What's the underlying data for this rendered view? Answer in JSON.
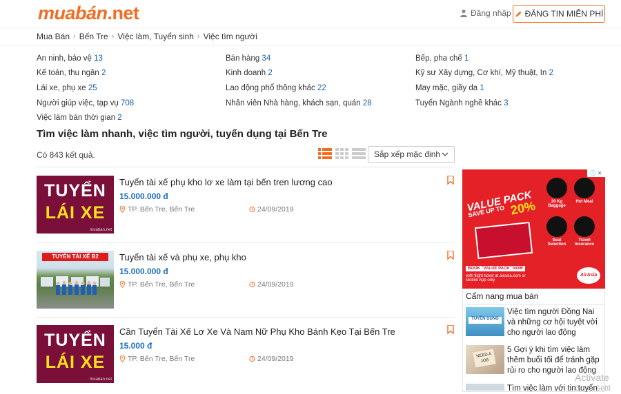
{
  "header": {
    "logo_main": "muabán",
    "logo_suffix": ".net",
    "login_label": "Đăng nhập",
    "post_button_label": "ĐĂNG TIN MIỄN PHÍ"
  },
  "breadcrumb": [
    "Mua Bán",
    "Bến Tre",
    "Việc làm, Tuyển sinh",
    "Việc tìm người"
  ],
  "categories": [
    {
      "label": "An ninh, bảo vệ",
      "count": "13"
    },
    {
      "label": "Bán hàng",
      "count": "34"
    },
    {
      "label": "Bếp, pha chế",
      "count": "1"
    },
    {
      "label": "Kế toán, thu ngân",
      "count": "2"
    },
    {
      "label": "Kinh doanh",
      "count": "2"
    },
    {
      "label": "Kỹ sư Xây dựng, Cơ khí, Mỹ thuật, In",
      "count": "2"
    },
    {
      "label": "Lái xe, phụ xe",
      "count": "25"
    },
    {
      "label": "Lao động phổ thông khác",
      "count": "22"
    },
    {
      "label": "May mặc, giầy da",
      "count": "1"
    },
    {
      "label": "Người giúp việc, tạp vụ",
      "count": "708"
    },
    {
      "label": "Nhân viên Nhà hàng, khách sạn, quán",
      "count": "28"
    },
    {
      "label": "Tuyển Ngành nghề khác",
      "count": "3"
    },
    {
      "label": "Việc làm bán thời gian",
      "count": "2"
    }
  ],
  "page_title": "Tìm việc làm nhanh, việc tìm người, tuyển dụng tại Bến Tre",
  "result_count": "Có 843 kết quả.",
  "sort": {
    "selected": "Sắp xếp mặc định"
  },
  "listings": [
    {
      "title": "Tuyển tài xế phụ kho lơ xe làm tại bến tren lương cao",
      "price": "15.000.000 đ",
      "location": "TP. Bến Tre, Bến Tre",
      "date": "24/09/2019",
      "thumb_line1": "TUYỂN",
      "thumb_line2": "LÁI XE",
      "thumb_wm": "muabán.net"
    },
    {
      "title": "Tuyển tài xế và phụ xe, phụ kho",
      "price": "15.000.000 đ",
      "location": "TP. Bến Tre, Bến Tre",
      "date": "24/09/2019",
      "thumb_banner": "TUYỂN TÀI XẾ B2"
    },
    {
      "title": "Cần Tuyển Tài Xế Lơ Xe Và Nam Nữ Phụ Kho Bánh Kẹo Tại Bến Tre",
      "price": "15.000 đ",
      "location": "TP. Bến Tre, Bến Tre",
      "date": "24/09/2019",
      "thumb_line1": "TUYỂN",
      "thumb_line2": "LÁI XE",
      "thumb_wm": "muabán.net"
    }
  ],
  "ad": {
    "line1": "VALUE PACK",
    "line2": "SAVE UP TO",
    "percent": "20%",
    "book_now": "BOOK \"VALUE PACK\" NOW",
    "site_text": "with flight ticket at airasia.com or Mobile App only",
    "features": [
      "20 Kg Baggage",
      "Hot Meal",
      "Seat Selection",
      "Travel Insurance"
    ],
    "brand": "AirAsia",
    "badge": "ⓘ ✕"
  },
  "guide": {
    "title": "Cẩm nang mua bán",
    "items": [
      {
        "text": "Việc tìm người Đồng Nai và những cơ hội tuyệt vời cho người lao động",
        "img_label": "TUYỂN DỤNG"
      },
      {
        "text": "5 Gợi ý khi tìm việc làm thêm buổi tối để tránh gặp rủi ro cho người lao động",
        "img_label": "NEED A JOB"
      },
      {
        "text": "Tìm việc làm với tin tuyển"
      }
    ]
  },
  "watermark": {
    "line1": "Activate",
    "line2": "Go to Setti"
  },
  "colors": {
    "brand_orange": "#f26d21",
    "price_blue": "#1a6ec2",
    "count_blue": "#1a5ea8"
  }
}
